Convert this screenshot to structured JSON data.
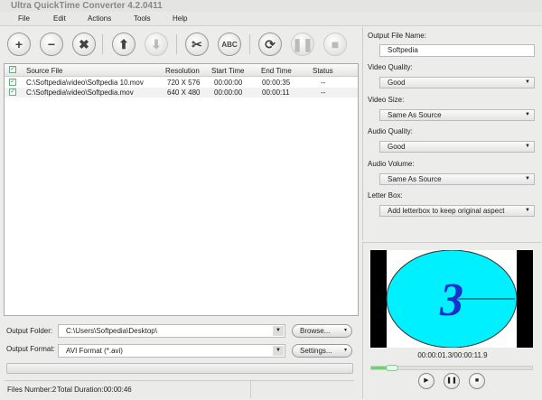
{
  "window": {
    "title": "Ultra QuickTime Converter 4.2.0411"
  },
  "menu": [
    "File",
    "Edit",
    "Actions",
    "Tools",
    "Help"
  ],
  "toolbar": [
    {
      "name": "add-icon",
      "glyph": "+"
    },
    {
      "name": "remove-icon",
      "glyph": "−"
    },
    {
      "name": "clear-icon",
      "glyph": "✖"
    },
    {
      "name": "move-up-icon",
      "glyph": "⬆"
    },
    {
      "name": "move-down-icon",
      "glyph": "⬇"
    },
    {
      "name": "trim-icon",
      "glyph": "✂"
    },
    {
      "name": "rename-icon",
      "glyph": "ABC"
    },
    {
      "name": "convert-icon",
      "glyph": "⟳"
    },
    {
      "name": "pause-icon",
      "glyph": "❚❚"
    },
    {
      "name": "stop-icon",
      "glyph": "■"
    }
  ],
  "list": {
    "columns": [
      "Source File",
      "Resolution",
      "Start Time",
      "End Time",
      "Status"
    ],
    "rows": [
      {
        "file": "C:\\Softpedia\\video\\Softpedia 10.mov",
        "resolution": "720 X 576",
        "start": "00:00:00",
        "end": "00:00:35",
        "status": "--"
      },
      {
        "file": "C:\\Softpedia\\video\\Softpedia.mov",
        "resolution": "640 X 480",
        "start": "00:00:00",
        "end": "00:00:11",
        "status": "--"
      }
    ]
  },
  "output": {
    "folder_label": "Output Folder:",
    "folder": "C:\\Users\\Softpedia\\Desktop\\",
    "browse": "Browse...",
    "format_label": "Output Format:",
    "format": "AVI Format (*.avi)",
    "settings": "Settings..."
  },
  "status": {
    "files": "Files Number:2",
    "duration": "Total Duration:00:00:46"
  },
  "settings": {
    "name_label": "Output File Name:",
    "name": "Softpedia",
    "items": [
      {
        "label": "Video Quality:",
        "value": "Good"
      },
      {
        "label": "Video Size:",
        "value": "Same As Source"
      },
      {
        "label": "Audio Quality:",
        "value": "Good"
      },
      {
        "label": "Audio Volume:",
        "value": "Same As Source"
      },
      {
        "label": "Letter Box:",
        "value": "Add letterbox to keep original aspect"
      }
    ]
  },
  "preview": {
    "frame_text": "3",
    "time": "00:00:01.3/00:00:11.9",
    "progress": 0.11,
    "colors": {
      "clock": "#00f0ff",
      "digit": "#1a2fd0"
    }
  }
}
